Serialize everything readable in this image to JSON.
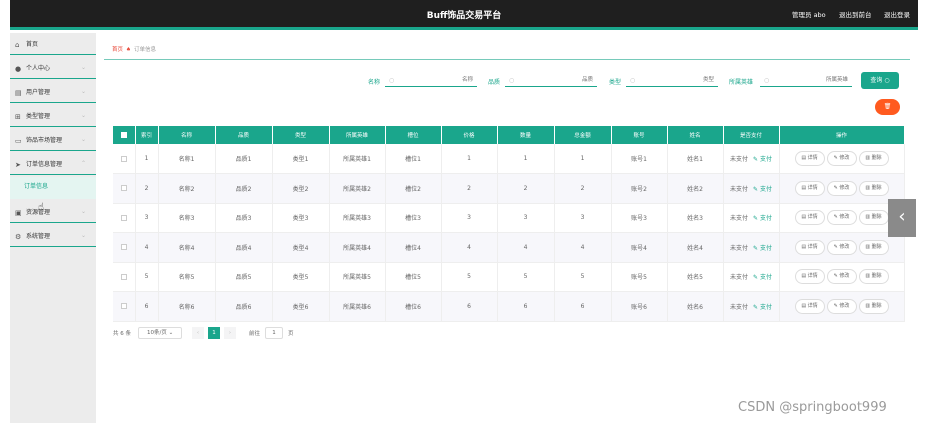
{
  "header": {
    "title": "Buff饰品交易平台",
    "admin": "管理员 abo",
    "exit_to_front": "退出到前台",
    "logout": "退出登录"
  },
  "sidebar": {
    "items": [
      {
        "label": "首页",
        "icon": "home-icon"
      },
      {
        "label": "个人中心",
        "icon": "user-icon"
      },
      {
        "label": "用户管理",
        "icon": "users-icon"
      },
      {
        "label": "类型管理",
        "icon": "grid-icon"
      },
      {
        "label": "饰品市场管理",
        "icon": "market-icon"
      },
      {
        "label": "订单信息管理",
        "icon": "send-icon"
      },
      {
        "label": "资源管理",
        "icon": "folder-icon"
      },
      {
        "label": "系统管理",
        "icon": "settings-icon"
      }
    ],
    "sub_item": "订单信息"
  },
  "breadcrumb": {
    "home": "首页",
    "current": "订单信息"
  },
  "filters": [
    {
      "label": "名称",
      "placeholder": "名称"
    },
    {
      "label": "品质",
      "placeholder": "品质"
    },
    {
      "label": "类型",
      "placeholder": "类型"
    },
    {
      "label": "所属英雄",
      "placeholder": "所属英雄"
    }
  ],
  "query_button": "查询",
  "table": {
    "columns": [
      "索引",
      "名称",
      "品质",
      "类型",
      "所属英雄",
      "槽位",
      "价格",
      "数量",
      "总金额",
      "账号",
      "姓名",
      "是否支付",
      "操作"
    ],
    "rows": [
      [
        "1",
        "名称1",
        "品质1",
        "类型1",
        "所属英雄1",
        "槽位1",
        "1",
        "1",
        "1",
        "账号1",
        "姓名1",
        "未支付"
      ],
      [
        "2",
        "名称2",
        "品质2",
        "类型2",
        "所属英雄2",
        "槽位2",
        "2",
        "2",
        "2",
        "账号2",
        "姓名2",
        "未支付"
      ],
      [
        "3",
        "名称3",
        "品质3",
        "类型3",
        "所属英雄3",
        "槽位3",
        "3",
        "3",
        "3",
        "账号3",
        "姓名3",
        "未支付"
      ],
      [
        "4",
        "名称4",
        "品质4",
        "类型4",
        "所属英雄4",
        "槽位4",
        "4",
        "4",
        "4",
        "账号4",
        "姓名4",
        "未支付"
      ],
      [
        "5",
        "名称5",
        "品质5",
        "类型5",
        "所属英雄5",
        "槽位5",
        "5",
        "5",
        "5",
        "账号5",
        "姓名5",
        "未支付"
      ],
      [
        "6",
        "名称6",
        "品质6",
        "类型6",
        "所属英雄6",
        "槽位6",
        "6",
        "6",
        "6",
        "账号6",
        "姓名6",
        "未支付"
      ]
    ],
    "pay_label": "支付",
    "op_detail": "详情",
    "op_edit": "修改",
    "op_delete": "删除"
  },
  "pagination": {
    "total": "共 6 条",
    "page_size": "10条/页",
    "current_page": "1",
    "goto_label": "前往",
    "goto_value": "1",
    "page_unit": "页"
  },
  "watermark": "CSDN @springboot999",
  "colors": {
    "accent": "#1aa68c",
    "danger": "#ff5a1f",
    "header_bg": "#1f1f1f"
  }
}
